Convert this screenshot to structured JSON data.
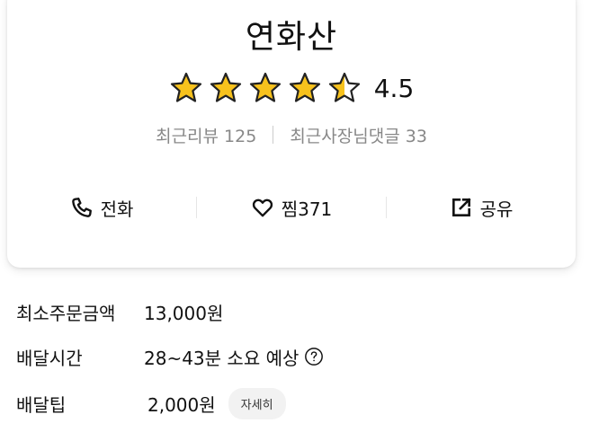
{
  "store": {
    "name": "연화산",
    "rating": 4.5,
    "rating_text": "4.5",
    "stars_total": 5
  },
  "counts": {
    "recent_reviews": "최근리뷰 125",
    "owner_comments": "최근사장님댓글 33"
  },
  "actions": {
    "call_label": "전화",
    "favorite_label": "찜371",
    "share_label": "공유"
  },
  "info": {
    "min_order_label": "최소주문금액",
    "min_order_value": "13,000원",
    "delivery_time_label": "배달시간",
    "delivery_time_value": "28~43분 소요 예상",
    "delivery_tip_label": "배달팁",
    "delivery_tip_value": "2,000원",
    "detail_button": "자세히"
  },
  "icons": {
    "call": "phone-icon",
    "favorite": "heart-icon",
    "share": "share-icon",
    "help": "question-circle-icon"
  },
  "colors": {
    "star_fill": "#F7C21D",
    "star_outline": "#222222",
    "muted_text": "#888888"
  }
}
